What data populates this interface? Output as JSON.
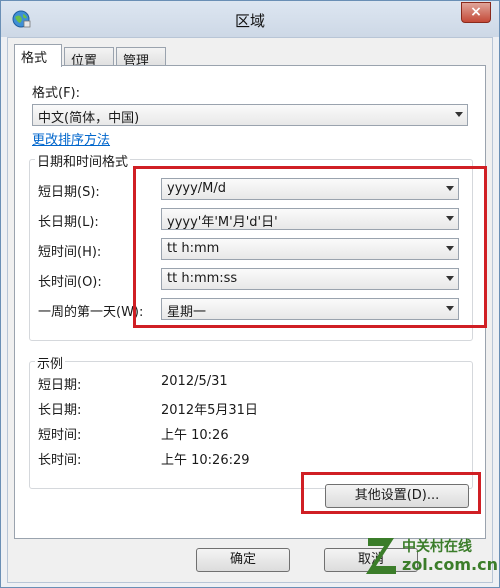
{
  "window": {
    "title": "区域",
    "close_label": "×"
  },
  "tabs": [
    {
      "label": "格式"
    },
    {
      "label": "位置"
    },
    {
      "label": "管理"
    }
  ],
  "format": {
    "label": "格式(F):",
    "value": "中文(简体，中国)",
    "sort_link": "更改排序方法"
  },
  "datetime_group": {
    "title": "日期和时间格式",
    "rows": [
      {
        "label": "短日期(S):",
        "value": "yyyy/M/d"
      },
      {
        "label": "长日期(L):",
        "value": "yyyy'年'M'月'd'日'"
      },
      {
        "label": "短时间(H):",
        "value": "tt h:mm"
      },
      {
        "label": "长时间(O):",
        "value": "tt h:mm:ss"
      },
      {
        "label": "一周的第一天(W):",
        "value": "星期一"
      }
    ]
  },
  "example_group": {
    "title": "示例",
    "rows": [
      {
        "label": "短日期:",
        "value": "2012/5/31"
      },
      {
        "label": "长日期:",
        "value": "2012年5月31日"
      },
      {
        "label": "短时间:",
        "value": "上午 10:26"
      },
      {
        "label": "长时间:",
        "value": "上午 10:26:29"
      }
    ]
  },
  "buttons": {
    "other_settings": "其他设置(D)...",
    "ok": "确定",
    "cancel": "取消"
  },
  "watermark": {
    "line1": "中关村在线",
    "line2": "zol.com.cn"
  },
  "colors": {
    "highlight": "#d01f24",
    "link": "#0066cc",
    "watermark": "#3b7d2a"
  }
}
